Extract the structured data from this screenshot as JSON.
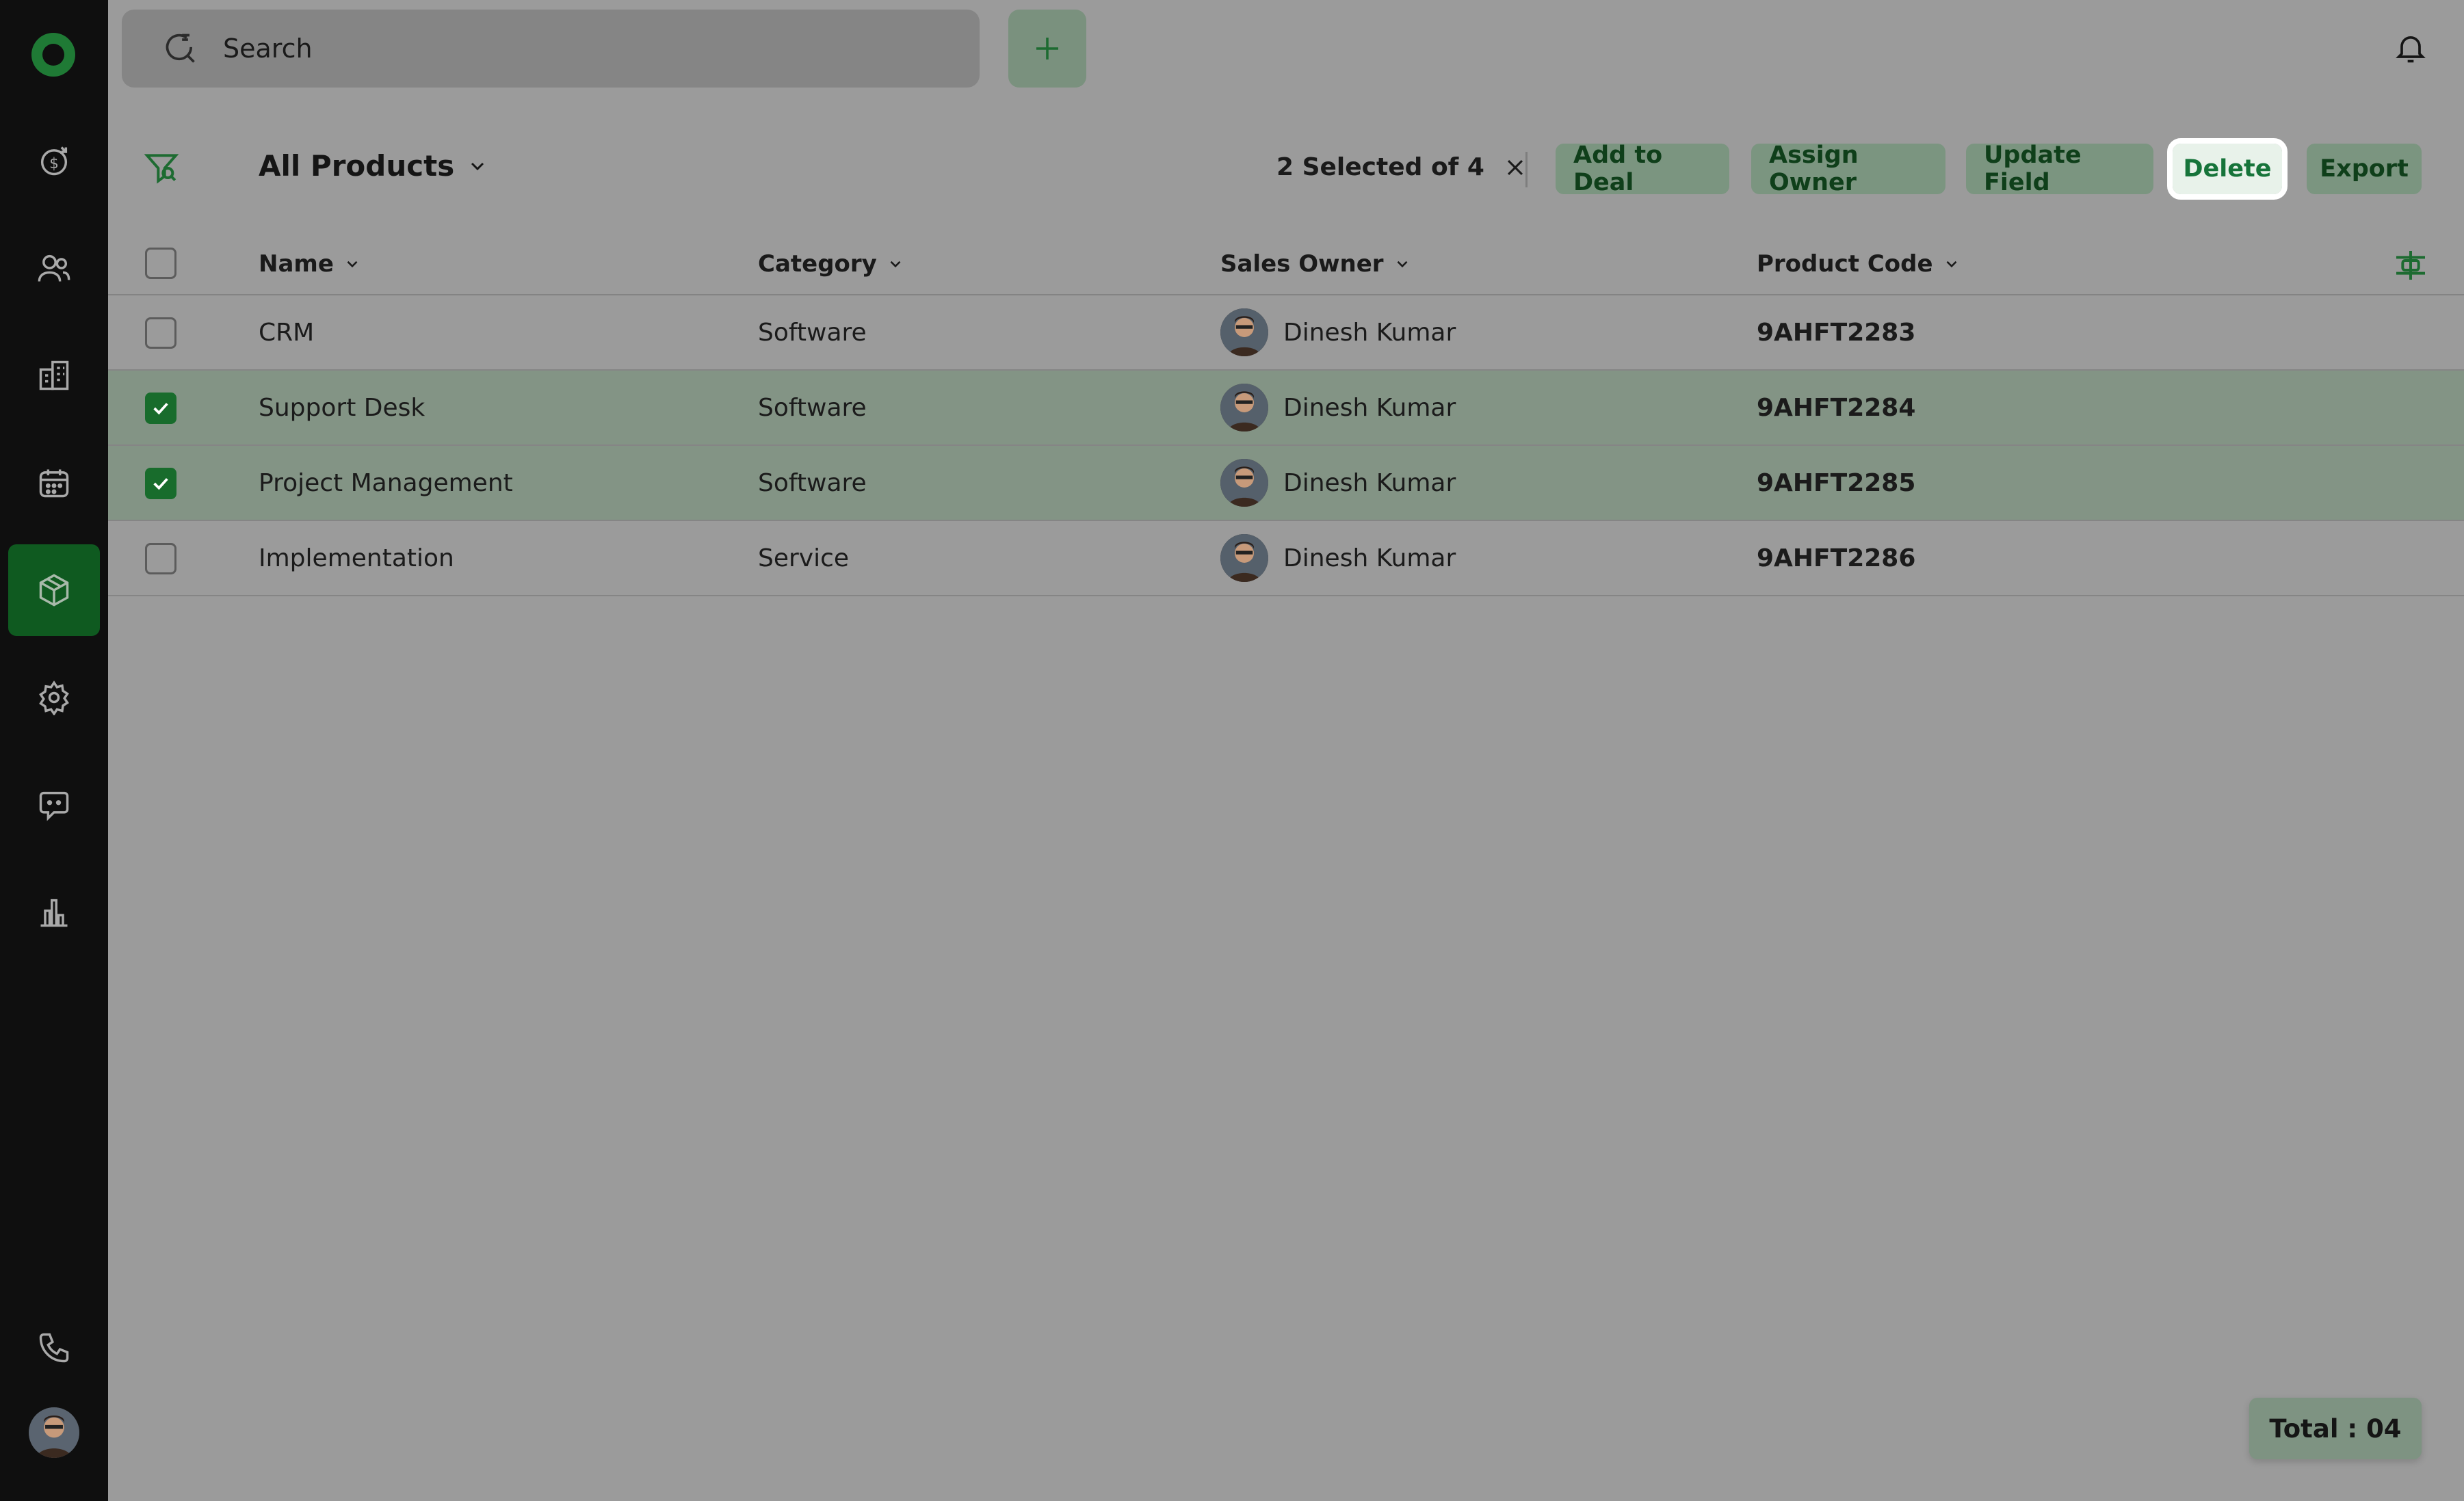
{
  "search": {
    "placeholder": "Search"
  },
  "toolbar": {
    "view_title": "All Products",
    "selected_text": "2 Selected of 4",
    "actions": [
      "Add to Deal",
      "Assign Owner",
      "Update Field",
      "Delete",
      "Export"
    ]
  },
  "table": {
    "columns": [
      "Name",
      "Category",
      "Sales Owner",
      "Product Code"
    ],
    "rows": [
      {
        "name": "CRM",
        "category": "Software",
        "owner": "Dinesh Kumar",
        "code": "9AHFT2283",
        "checked": false
      },
      {
        "name": "Support Desk",
        "category": "Software",
        "owner": "Dinesh Kumar",
        "code": "9AHFT2284",
        "checked": true
      },
      {
        "name": "Project Management",
        "category": "Software",
        "owner": "Dinesh Kumar",
        "code": "9AHFT2285",
        "checked": true
      },
      {
        "name": "Implementation",
        "category": "Service",
        "owner": "Dinesh Kumar",
        "code": "9AHFT2286",
        "checked": false
      }
    ]
  },
  "footer": {
    "total": "Total : 04"
  },
  "colors": {
    "accent": "#186c2c",
    "sidebar": "#0f0f0f",
    "highlight_button": "#e8f2ea"
  },
  "sidebar": {
    "icons": [
      "deals-icon",
      "contacts-icon",
      "companies-icon",
      "calendar-icon",
      "products-icon",
      "settings-icon",
      "chat-icon",
      "reports-icon",
      "phone-icon"
    ]
  }
}
